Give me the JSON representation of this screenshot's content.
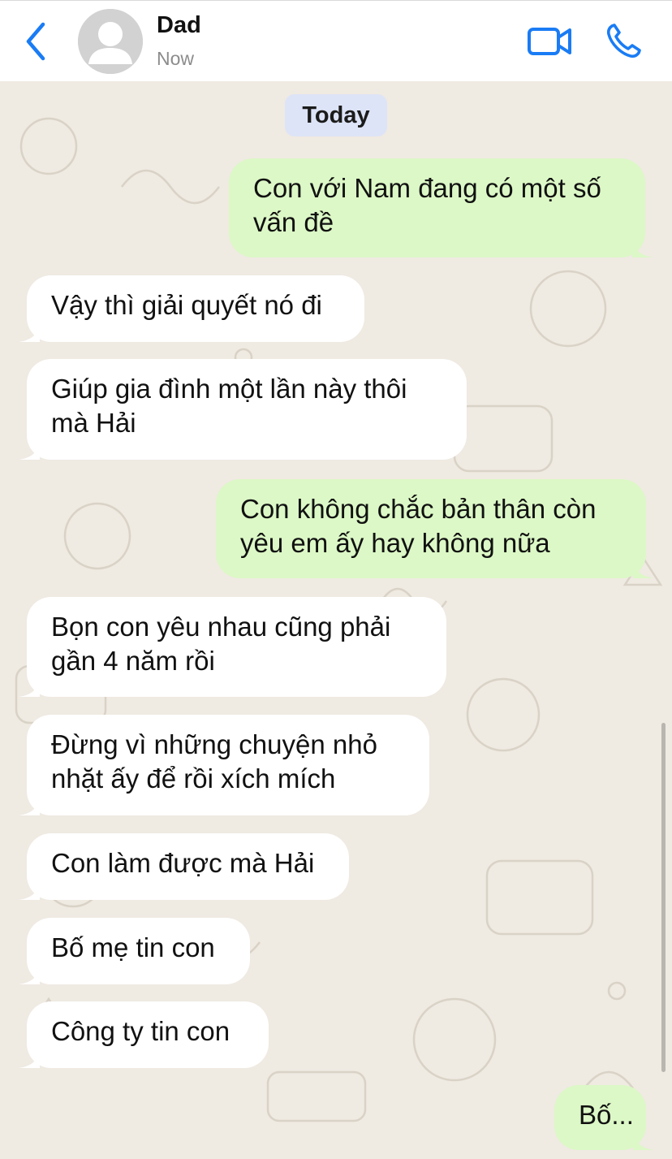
{
  "header": {
    "contact_name": "Dad",
    "status": "Now",
    "accent_color": "#1a7cf5"
  },
  "icons": {
    "back": "chevron-left-icon",
    "video": "video-camera-icon",
    "call": "phone-icon",
    "avatar": "person-silhouette"
  },
  "chat": {
    "date_label": "Today",
    "messages": [
      {
        "dir": "out",
        "text": "Con với Nam đang có một số vấn đề"
      },
      {
        "dir": "in",
        "text": "Vậy thì giải quyết nó đi"
      },
      {
        "dir": "in",
        "text": "Giúp gia đình một lần này thôi mà Hải"
      },
      {
        "dir": "out",
        "text": "Con không chắc bản thân còn yêu em ấy hay không nữa"
      },
      {
        "dir": "in",
        "text": "Bọn con yêu nhau cũng phải gần 4 năm rồi"
      },
      {
        "dir": "in",
        "text": "Đừng vì những chuyện nhỏ nhặt ấy để rồi xích mích"
      },
      {
        "dir": "in",
        "text": "Con làm được mà Hải"
      },
      {
        "dir": "in",
        "text": "Bố mẹ tin con"
      },
      {
        "dir": "in",
        "text": "Công ty tin con"
      },
      {
        "dir": "out",
        "text": "Bố..."
      }
    ]
  }
}
